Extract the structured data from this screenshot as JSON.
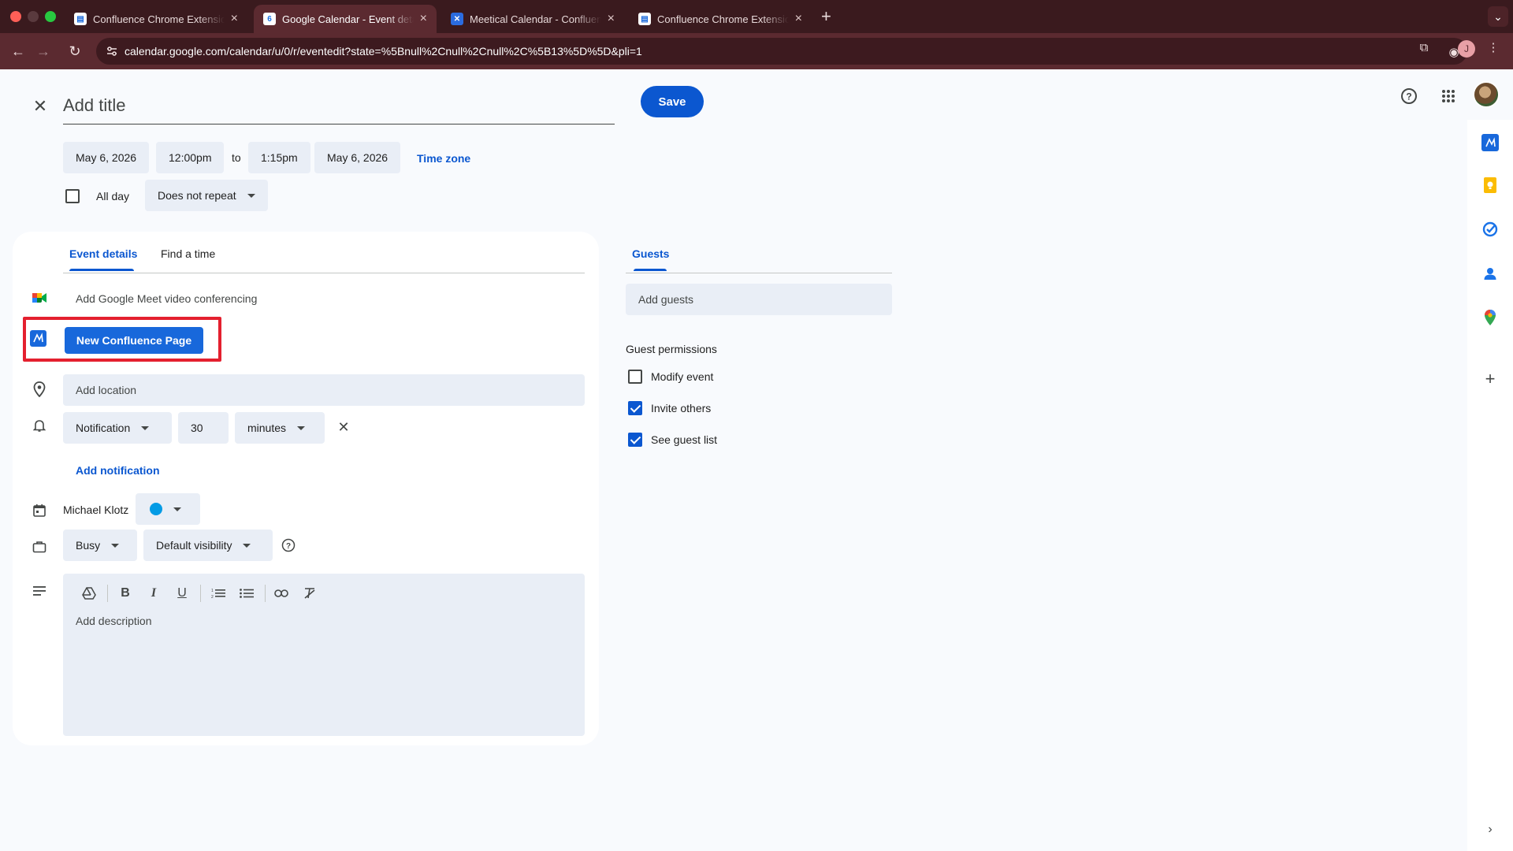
{
  "browser": {
    "tabs": [
      {
        "title": "Confluence Chrome Extension",
        "favicon": "confluence-page-icon",
        "active": false
      },
      {
        "title": "Google Calendar - Event details",
        "favicon": "google-calendar-icon",
        "active": true
      },
      {
        "title": "Meetical Calendar - Confluence",
        "favicon": "meetical-icon",
        "active": false
      },
      {
        "title": "Confluence Chrome Extension",
        "favicon": "confluence-page-icon",
        "active": false
      }
    ],
    "url": "calendar.google.com/calendar/u/0/r/eventedit?state=%5Bnull%2Cnull%2Cnull%2C%5B13%5D%5D&pli=1"
  },
  "event": {
    "title_placeholder": "Add title",
    "save_label": "Save",
    "start_date": "May 6, 2026",
    "start_time": "12:00pm",
    "to_label": "to",
    "end_time": "1:15pm",
    "end_date": "May 6, 2026",
    "timezone_label": "Time zone",
    "all_day_label": "All day",
    "all_day_checked": false,
    "repeat_value": "Does not repeat"
  },
  "tabs": {
    "event_details": "Event details",
    "find_a_time": "Find a time",
    "guests": "Guests"
  },
  "details": {
    "meet_label": "Add Google Meet video conferencing",
    "confluence_button": "New Confluence Page",
    "location_placeholder": "Add location",
    "notification_type": "Notification",
    "notification_amount": "30",
    "notification_unit": "minutes",
    "add_notification": "Add notification",
    "calendar_owner": "Michael Klotz",
    "calendar_color": "#039be5",
    "availability": "Busy",
    "visibility": "Default visibility",
    "description_placeholder": "Add description"
  },
  "guests": {
    "add_placeholder": "Add guests",
    "permissions_title": "Guest permissions",
    "permissions": [
      {
        "label": "Modify event",
        "checked": false
      },
      {
        "label": "Invite others",
        "checked": true
      },
      {
        "label": "See guest list",
        "checked": true
      }
    ]
  },
  "colors": {
    "accent": "#0b57d0",
    "highlight": "#e4202f",
    "confluence_blue": "#1868db"
  }
}
